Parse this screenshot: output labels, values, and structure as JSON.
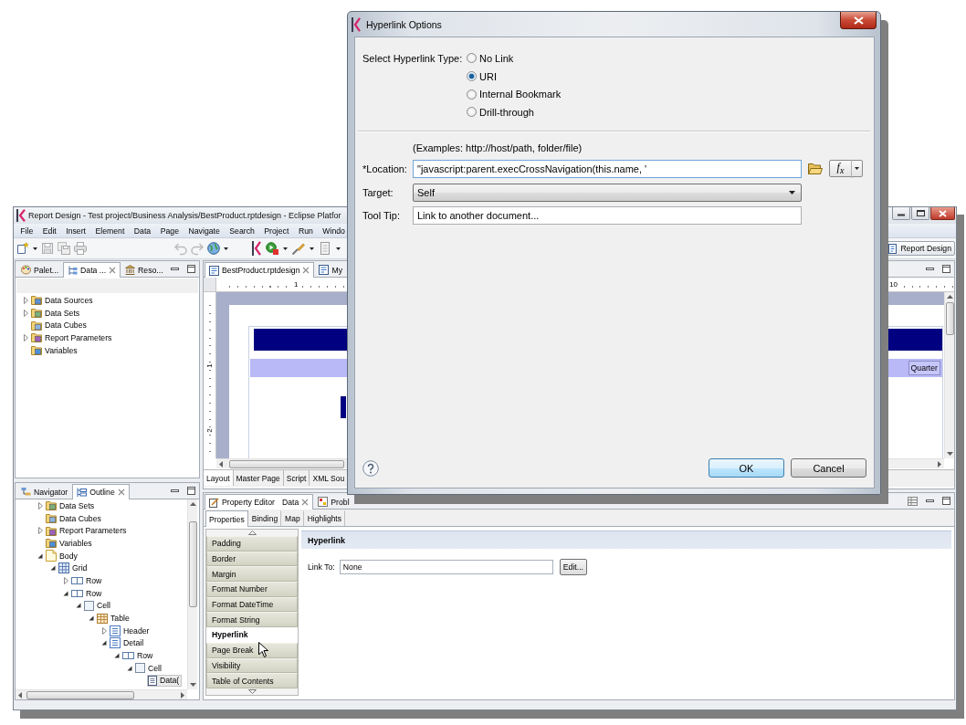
{
  "eclipse_window": {
    "title": "Report Design - Test project/Business Analysis/BestProduct.rptdesign - Eclipse Platfor",
    "menu": [
      "File",
      "Edit",
      "Insert",
      "Element",
      "Data",
      "Page",
      "Navigate",
      "Search",
      "Project",
      "Run",
      "Windo"
    ],
    "perspective_button": "Report Design",
    "data_explorer": {
      "tabs": [
        {
          "label": "Palet...",
          "kind": "palette",
          "selected": false
        },
        {
          "label": "Data ...",
          "kind": "data",
          "selected": true
        },
        {
          "label": "Reso...",
          "kind": "resource",
          "selected": false
        }
      ],
      "tree": [
        {
          "label": "Data Sources",
          "kind": "data_source",
          "expanded": false,
          "selected": false
        },
        {
          "label": "Data Sets",
          "kind": "data_set",
          "expanded": false,
          "selected": false
        },
        {
          "label": "Data Cubes",
          "kind": "data_cube",
          "selected": false
        },
        {
          "label": "Report Parameters",
          "kind": "parameter",
          "expanded": false,
          "selected": false
        },
        {
          "label": "Variables",
          "kind": "variable",
          "selected": false
        }
      ]
    },
    "outline": {
      "tabs": [
        {
          "label": "Navigator",
          "kind": "navigator",
          "selected": false
        },
        {
          "label": "Outline",
          "kind": "outline",
          "selected": true
        }
      ],
      "tree": [
        {
          "label": "Data Sets",
          "kind": "data_set",
          "expanded": false,
          "selected": false
        },
        {
          "label": "Data Cubes",
          "kind": "data_cube",
          "selected": false
        },
        {
          "label": "Report Parameters",
          "kind": "parameter",
          "expanded": false,
          "selected": false
        },
        {
          "label": "Variables",
          "kind": "variable",
          "selected": false
        },
        {
          "label": "Body",
          "kind": "body",
          "expanded": true,
          "selected": false,
          "children": [
            {
              "label": "Grid",
              "kind": "grid",
              "expanded": true,
              "selected": false,
              "children": [
                {
                  "label": "Row",
                  "kind": "row",
                  "expanded": false,
                  "selected": false
                },
                {
                  "label": "Row",
                  "kind": "row",
                  "expanded": true,
                  "selected": false,
                  "children": [
                    {
                      "label": "Cell",
                      "kind": "cell",
                      "expanded": true,
                      "selected": false,
                      "children": [
                        {
                          "label": "Table",
                          "kind": "table",
                          "expanded": true,
                          "selected": false,
                          "children": [
                            {
                              "label": "Header",
                              "kind": "band",
                              "expanded": false,
                              "selected": false
                            },
                            {
                              "label": "Detail",
                              "kind": "band",
                              "expanded": true,
                              "selected": false,
                              "children": [
                                {
                                  "label": "Row",
                                  "kind": "row",
                                  "expanded": true,
                                  "selected": false,
                                  "children": [
                                    {
                                      "label": "Cell",
                                      "kind": "cell",
                                      "expanded": true,
                                      "selected": false,
                                      "children": [
                                        {
                                          "label": "Data(",
                                          "kind": "data_item",
                                          "selected": true
                                        }
                                      ]
                                    }
                                  ]
                                }
                              ]
                            }
                          ]
                        }
                      ]
                    }
                  ]
                }
              ]
            }
          ]
        }
      ]
    },
    "editor": {
      "tabs": [
        {
          "label": "BestProduct.rptdesign",
          "kind": "report",
          "selected": true
        },
        {
          "label": "My",
          "kind": "report",
          "selected": false
        }
      ],
      "ruler_labels": [
        "1",
        "10"
      ],
      "side_ruler_labels": [
        "1",
        "2"
      ],
      "cell_text": "Quarter",
      "page_tabs": [
        {
          "label": "Layout",
          "selected": true
        },
        {
          "label": "Master Page",
          "selected": false
        },
        {
          "label": "Script",
          "selected": false
        },
        {
          "label": "XML Sou",
          "selected": false
        }
      ]
    },
    "property_editor": {
      "tabs": [
        {
          "label": "Property Editor",
          "detail": "Data",
          "kind": "properties",
          "selected": true
        },
        {
          "label": "Probl",
          "kind": "problems",
          "selected": false
        }
      ],
      "subtabs": [
        {
          "label": "Properties",
          "selected": true
        },
        {
          "label": "Binding",
          "selected": false
        },
        {
          "label": "Map",
          "selected": false
        },
        {
          "label": "Highlights",
          "selected": false
        }
      ],
      "categories": [
        {
          "label": "Padding",
          "selected": false
        },
        {
          "label": "Border",
          "selected": false
        },
        {
          "label": "Margin",
          "selected": false
        },
        {
          "label": "Format Number",
          "selected": false
        },
        {
          "label": "Format DateTime",
          "selected": false
        },
        {
          "label": "Format String",
          "selected": false
        },
        {
          "label": "Hyperlink",
          "selected": true
        },
        {
          "label": "Page Break",
          "selected": false
        },
        {
          "label": "Visibility",
          "selected": false
        },
        {
          "label": "Table of Contents",
          "selected": false
        }
      ],
      "section_title": "Hyperlink",
      "link_to": {
        "label": "Link To:",
        "value": "None"
      },
      "edit_button": "Edit..."
    }
  },
  "dialog": {
    "title": "Hyperlink Options",
    "type_label": "Select Hyperlink Type:",
    "types": [
      {
        "label": "No Link",
        "selected": false
      },
      {
        "label": "URI",
        "selected": true
      },
      {
        "label": "Internal Bookmark",
        "selected": false
      },
      {
        "label": "Drill-through",
        "selected": false
      }
    ],
    "examples": "(Examples: http://host/path, folder/file)",
    "location": {
      "label": "*Location:",
      "value": "\"javascript:parent.execCrossNavigation(this.name, '",
      "expression_button": "f$_{x}$"
    },
    "target": {
      "label": "Target:",
      "value": "Self"
    },
    "tooltip": {
      "label": "Tool Tip:",
      "value": "Link to another document..."
    },
    "buttons": [
      {
        "label": "OK",
        "default": true
      },
      {
        "label": "Cancel",
        "default": false
      }
    ]
  }
}
